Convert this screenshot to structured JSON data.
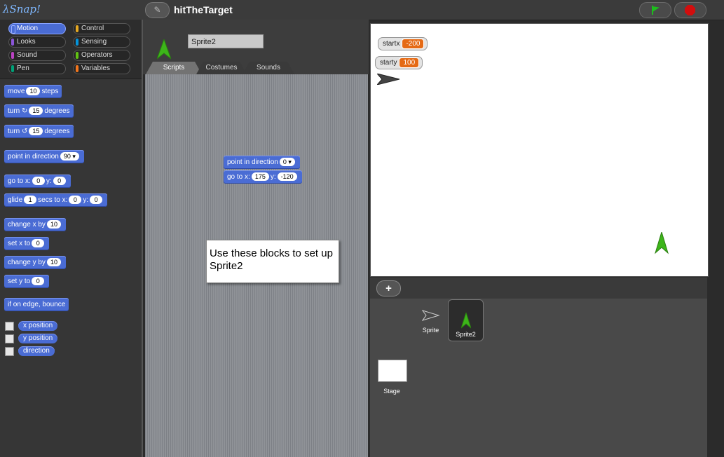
{
  "app": {
    "logo": "λSnap!",
    "project_title": "hitTheTarget"
  },
  "categories": [
    {
      "label": "Motion",
      "color": "#4a6cd4",
      "selected": true
    },
    {
      "label": "Control",
      "color": "#e6a822",
      "selected": false
    },
    {
      "label": "Looks",
      "color": "#8a55d7",
      "selected": false
    },
    {
      "label": "Sensing",
      "color": "#0494dc",
      "selected": false
    },
    {
      "label": "Sound",
      "color": "#bb42c3",
      "selected": false
    },
    {
      "label": "Operators",
      "color": "#62c213",
      "selected": false
    },
    {
      "label": "Pen",
      "color": "#00a178",
      "selected": false
    },
    {
      "label": "Variables",
      "color": "#f3761d",
      "selected": false
    }
  ],
  "palette": {
    "move": {
      "pre": "move",
      "val": "10",
      "post": "steps"
    },
    "turn_cw": {
      "pre": "turn",
      "icon": "↻",
      "val": "15",
      "post": "degrees"
    },
    "turn_ccw": {
      "pre": "turn",
      "icon": "↺",
      "val": "15",
      "post": "degrees"
    },
    "point_dir": {
      "pre": "point in direction",
      "val": "90 ▾"
    },
    "goto": {
      "pre": "go to x:",
      "x": "0",
      "mid": "y:",
      "y": "0"
    },
    "glide": {
      "pre": "glide",
      "secs": "1",
      "mid1": "secs to x:",
      "x": "0",
      "mid2": "y:",
      "y": "0"
    },
    "change_x": {
      "pre": "change x by",
      "val": "10"
    },
    "set_x": {
      "pre": "set x to",
      "val": "0"
    },
    "change_y": {
      "pre": "change y by",
      "val": "10"
    },
    "set_y": {
      "pre": "set y to",
      "val": "0"
    },
    "bounce": "if on edge, bounce",
    "reporters": [
      "x position",
      "y position",
      "direction"
    ]
  },
  "sprite": {
    "name": "Sprite2",
    "tabs": [
      "Scripts",
      "Costumes",
      "Sounds"
    ],
    "selected_tab": "Scripts"
  },
  "script": {
    "point_dir": {
      "pre": "point in direction",
      "val": "0 ▾"
    },
    "goto": {
      "pre": "go to x:",
      "x": "175",
      "mid": "y:",
      "y": "-120"
    }
  },
  "note": "Use these blocks to set up Sprite2",
  "stage": {
    "watchers": [
      {
        "label": "startx",
        "value": "-200"
      },
      {
        "label": "starty",
        "value": "100"
      }
    ]
  },
  "corral": {
    "add_label": "+",
    "sprites": [
      {
        "name": "Sprite",
        "selected": false
      },
      {
        "name": "Sprite2",
        "selected": true
      }
    ],
    "stage_label": "Stage"
  },
  "colors": {
    "motion": "#4a6cd4",
    "watcher_value": "#e56a15",
    "costume_green": "#3db51a"
  }
}
